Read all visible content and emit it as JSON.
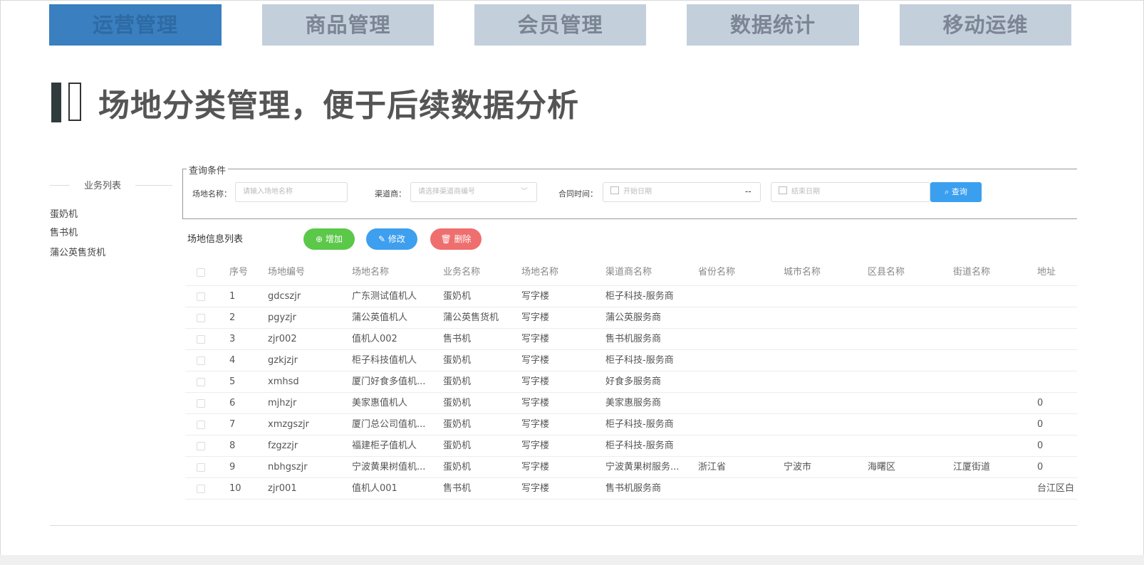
{
  "tabs": [
    {
      "label": "运营管理",
      "active": true
    },
    {
      "label": "商品管理",
      "active": false
    },
    {
      "label": "会员管理",
      "active": false
    },
    {
      "label": "数据统计",
      "active": false
    },
    {
      "label": "移动运维",
      "active": false
    }
  ],
  "headline": "场地分类管理，便于后续数据分析",
  "sidebar": {
    "title": "业务列表",
    "items": [
      "蛋奶机",
      "售书机",
      "蒲公英售货机"
    ]
  },
  "query": {
    "legend": "查询条件",
    "site_name_label": "场地名称：",
    "site_name_placeholder": "请输入场地名称",
    "channel_label": "渠道商：",
    "channel_placeholder": "请选择渠道商编号",
    "contract_label": "合同时间：",
    "start_placeholder": "开始日期",
    "separator": "--",
    "end_placeholder": "结束日期",
    "search_label": "查询"
  },
  "list": {
    "title": "场地信息列表",
    "add_label": "增加",
    "edit_label": "修改",
    "delete_label": "删除"
  },
  "table": {
    "columns": [
      "序号",
      "场地编号",
      "场地名称",
      "业务名称",
      "场地名称",
      "渠道商名称",
      "省份名称",
      "城市名称",
      "区县名称",
      "街道名称",
      "地址"
    ],
    "rows": [
      [
        "1",
        "gdcszjr",
        "广东测试值机人",
        "蛋奶机",
        "写字楼",
        "柜子科技-服务商",
        "",
        "",
        "",
        "",
        ""
      ],
      [
        "2",
        "pgyzjr",
        "蒲公英值机人",
        "蒲公英售货机",
        "写字楼",
        "蒲公英服务商",
        "",
        "",
        "",
        "",
        ""
      ],
      [
        "3",
        "zjr002",
        "值机人002",
        "售书机",
        "写字楼",
        "售书机服务商",
        "",
        "",
        "",
        "",
        ""
      ],
      [
        "4",
        "gzkjzjr",
        "柜子科技值机人",
        "蛋奶机",
        "写字楼",
        "柜子科技-服务商",
        "",
        "",
        "",
        "",
        ""
      ],
      [
        "5",
        "xmhsd",
        "厦门好食多值机...",
        "蛋奶机",
        "写字楼",
        "好食多服务商",
        "",
        "",
        "",
        "",
        ""
      ],
      [
        "6",
        "mjhzjr",
        "美家惠值机人",
        "蛋奶机",
        "写字楼",
        "美家惠服务商",
        "",
        "",
        "",
        "",
        "0"
      ],
      [
        "7",
        "xmzgszjr",
        "厦门总公司值机...",
        "蛋奶机",
        "写字楼",
        "柜子科技-服务商",
        "",
        "",
        "",
        "",
        "0"
      ],
      [
        "8",
        "fzgzzjr",
        "福建柜子值机人",
        "蛋奶机",
        "写字楼",
        "柜子科技-服务商",
        "",
        "",
        "",
        "",
        "0"
      ],
      [
        "9",
        "nbhgszjr",
        "宁波黄果树值机...",
        "蛋奶机",
        "写字楼",
        "宁波黄果树服务...",
        "浙江省",
        "宁波市",
        "海曙区",
        "江厦街道",
        "0"
      ],
      [
        "10",
        "zjr001",
        "值机人001",
        "售书机",
        "写字楼",
        "售书机服务商",
        "",
        "",
        "",
        "",
        "台江区白"
      ]
    ]
  },
  "colors": {
    "tab_active": "#3a7fbf",
    "tab_inactive": "#c4cfdc",
    "add_button": "#5cc84a",
    "edit_button": "#3e9fef",
    "delete_button": "#ef6f6f",
    "search_button": "#3b9ff0"
  },
  "icons": {
    "add": "plus-circle-icon",
    "edit": "pencil-icon",
    "delete": "trash-icon",
    "search": "search-icon",
    "calendar": "calendar-icon",
    "dropdown": "chevron-down-icon"
  }
}
